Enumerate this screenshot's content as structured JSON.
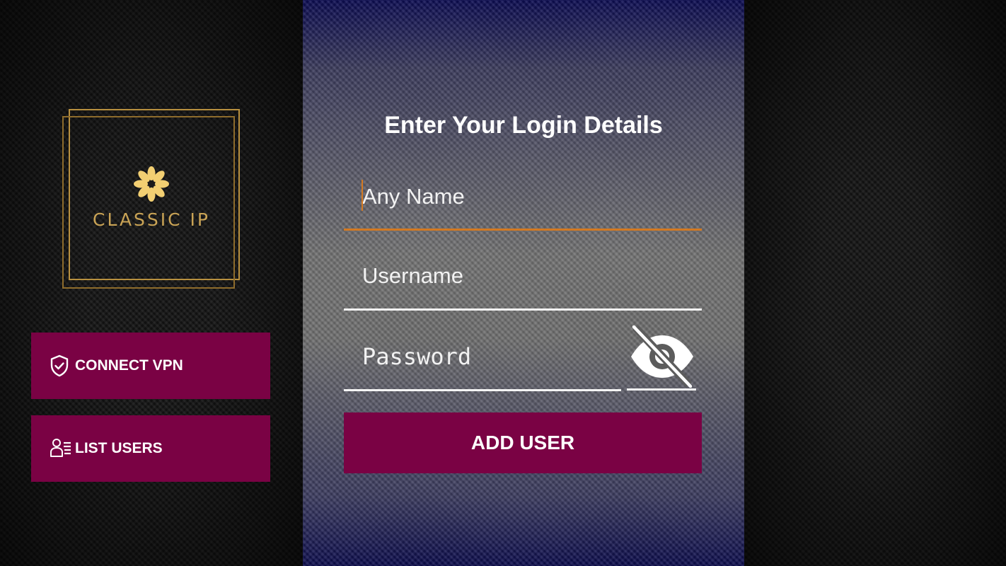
{
  "logo": {
    "brand": "CLASSIC IP",
    "icon": "flower-icon",
    "accent_color": "#c9a355"
  },
  "sidebar": {
    "connect_vpn": {
      "label": "CONNECT VPN",
      "icon": "shield-check-icon"
    },
    "list_users": {
      "label": "LIST USERS",
      "icon": "user-list-icon"
    }
  },
  "form": {
    "title": "Enter Your Login Details",
    "any_name": {
      "placeholder": "Any Name",
      "value": ""
    },
    "username": {
      "placeholder": "Username",
      "value": ""
    },
    "password": {
      "placeholder": "Password",
      "value": "",
      "visibility_icon": "eye-off-icon"
    },
    "add_user_label": "ADD USER"
  },
  "colors": {
    "button": "#7a0244",
    "focus_underline": "#d47a22",
    "text": "#ffffff"
  }
}
